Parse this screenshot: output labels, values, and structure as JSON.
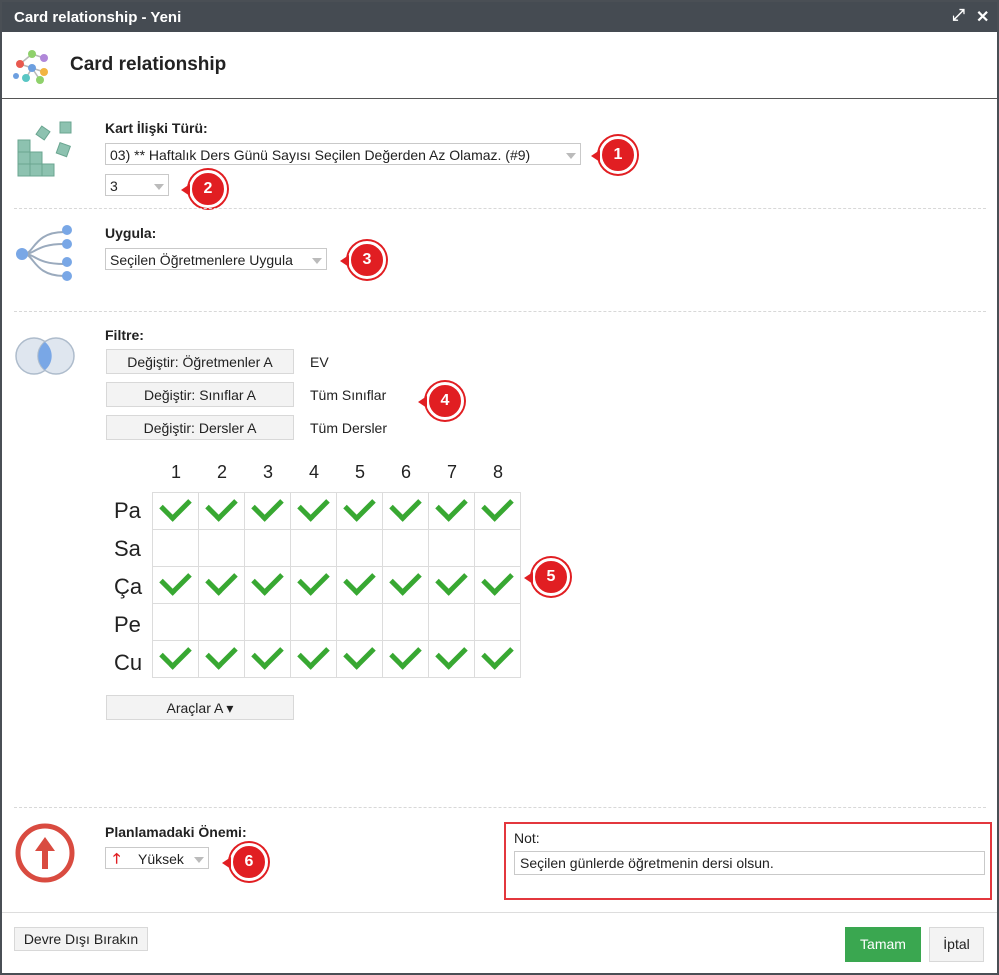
{
  "window": {
    "title": "Card relationship - Yeni"
  },
  "header": {
    "title": "Card relationship"
  },
  "relation_type": {
    "label": "Kart İlişki Türü:",
    "selected": "03) ** Haftalık Ders Günü Sayısı Seçilen Değerden Az Olamaz. (#9)",
    "value": "3"
  },
  "apply": {
    "label": "Uygula:",
    "selected": "Seçilen Öğretmenlere Uygula"
  },
  "filter": {
    "label": "Filtre:",
    "rows": [
      {
        "button": "Değiştir: Öğretmenler A",
        "value": "EV"
      },
      {
        "button": "Değiştir: Sınıflar A",
        "value": "Tüm Sınıflar"
      },
      {
        "button": "Değiştir: Dersler A",
        "value": "Tüm Dersler"
      }
    ]
  },
  "schedule": {
    "columns": [
      "1",
      "2",
      "3",
      "4",
      "5",
      "6",
      "7",
      "8"
    ],
    "rows": [
      {
        "day": "Pa",
        "checked": [
          true,
          true,
          true,
          true,
          true,
          true,
          true,
          true
        ]
      },
      {
        "day": "Sa",
        "checked": [
          false,
          false,
          false,
          false,
          false,
          false,
          false,
          false
        ]
      },
      {
        "day": "Ça",
        "checked": [
          true,
          true,
          true,
          true,
          true,
          true,
          true,
          true
        ]
      },
      {
        "day": "Pe",
        "checked": [
          false,
          false,
          false,
          false,
          false,
          false,
          false,
          false
        ]
      },
      {
        "day": "Cu",
        "checked": [
          true,
          true,
          true,
          true,
          true,
          true,
          true,
          true
        ]
      }
    ],
    "tools_button": "Araçlar A ▾"
  },
  "importance": {
    "label": "Planlamadaki Önemi:",
    "selected": "Yüksek"
  },
  "note": {
    "label": "Not:",
    "value": "Seçilen günlerde öğretmenin dersi olsun."
  },
  "badges": [
    "1",
    "2",
    "3",
    "4",
    "5",
    "6"
  ],
  "footer": {
    "disable": "Devre Dışı Bırakın",
    "ok": "Tamam",
    "cancel": "İptal"
  },
  "colors": {
    "titlebar": "#454b52",
    "check": "#38a832",
    "badge": "#e11e22",
    "ok": "#3aa750",
    "highlight": "#e3373d"
  }
}
